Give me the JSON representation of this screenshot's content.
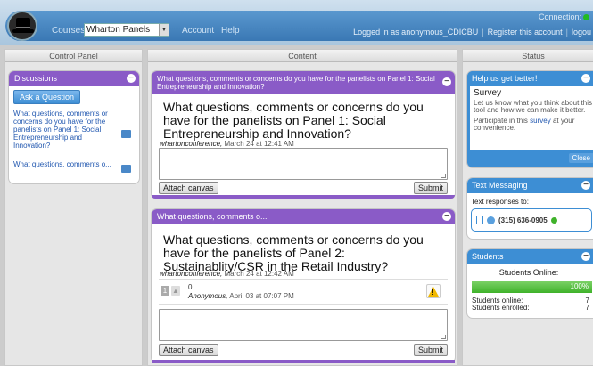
{
  "topbar": {
    "courses_label": "Courses",
    "course_selected": "Wharton Panels",
    "account_label": "Account",
    "help_label": "Help",
    "connection_label": "Connection:",
    "logged_in_text": "Logged in as anonymous_CDICBU",
    "register_label": "Register this account",
    "logout_label": "logou"
  },
  "columns": {
    "control_panel": "Control Panel",
    "content": "Content",
    "status": "Status"
  },
  "discussions": {
    "title": "Discussions",
    "ask_button": "Ask a Question",
    "items": [
      {
        "text": "What questions, comments or concerns do you have for the panelists on Panel 1: Social Entrepreneurship and Innovation?"
      },
      {
        "text": "What questions, comments o..."
      }
    ]
  },
  "posts": [
    {
      "header": "What questions, comments or concerns do you have for the panelists on Panel 1: Social Entrepreneurship and Innovation?",
      "question": "What questions, comments or concerns do you have for the panelists on Panel 1: Social Entrepreneurship and Innovation?",
      "author": "whartonconference,",
      "date": "March 24 at 12:41 AM",
      "attach_label": "Attach canvas",
      "submit_label": "Submit"
    },
    {
      "header": "What questions, comments o...",
      "question": "What questions, comments or concerns do you have for the panelists of Panel 2: Sustainablity/CSR in the Retail Industry?",
      "author": "whartonconference,",
      "date": "March 24 at 12:42 AM",
      "reply": {
        "votes": "0",
        "author": "Anonymous,",
        "date": "April 03 at 07:07 PM"
      },
      "attach_label": "Attach canvas",
      "submit_label": "Submit"
    }
  ],
  "help_box": {
    "title": "Help us get better!",
    "survey_title": "Survey",
    "text1": "Let us know what you think about this tool and how we can make it better.",
    "text2_pre": "Participate in this",
    "text2_link": "survey",
    "text2_post": "at your convenience.",
    "close_label": "Close"
  },
  "texting": {
    "title": "Text Messaging",
    "label": "Text responses to:",
    "number": "(315) 636-0905"
  },
  "students": {
    "title": "Students",
    "online_label": "Students Online:",
    "progress_text": "100%",
    "progress_value": 1.0,
    "rows": [
      {
        "label": "Students online:",
        "value": "7"
      },
      {
        "label": "Students enrolled:",
        "value": "7"
      }
    ]
  },
  "colors": {
    "accent_purple": "#8a5bc7",
    "accent_blue": "#3d8ed4",
    "progress_green": "#3fb22a"
  }
}
